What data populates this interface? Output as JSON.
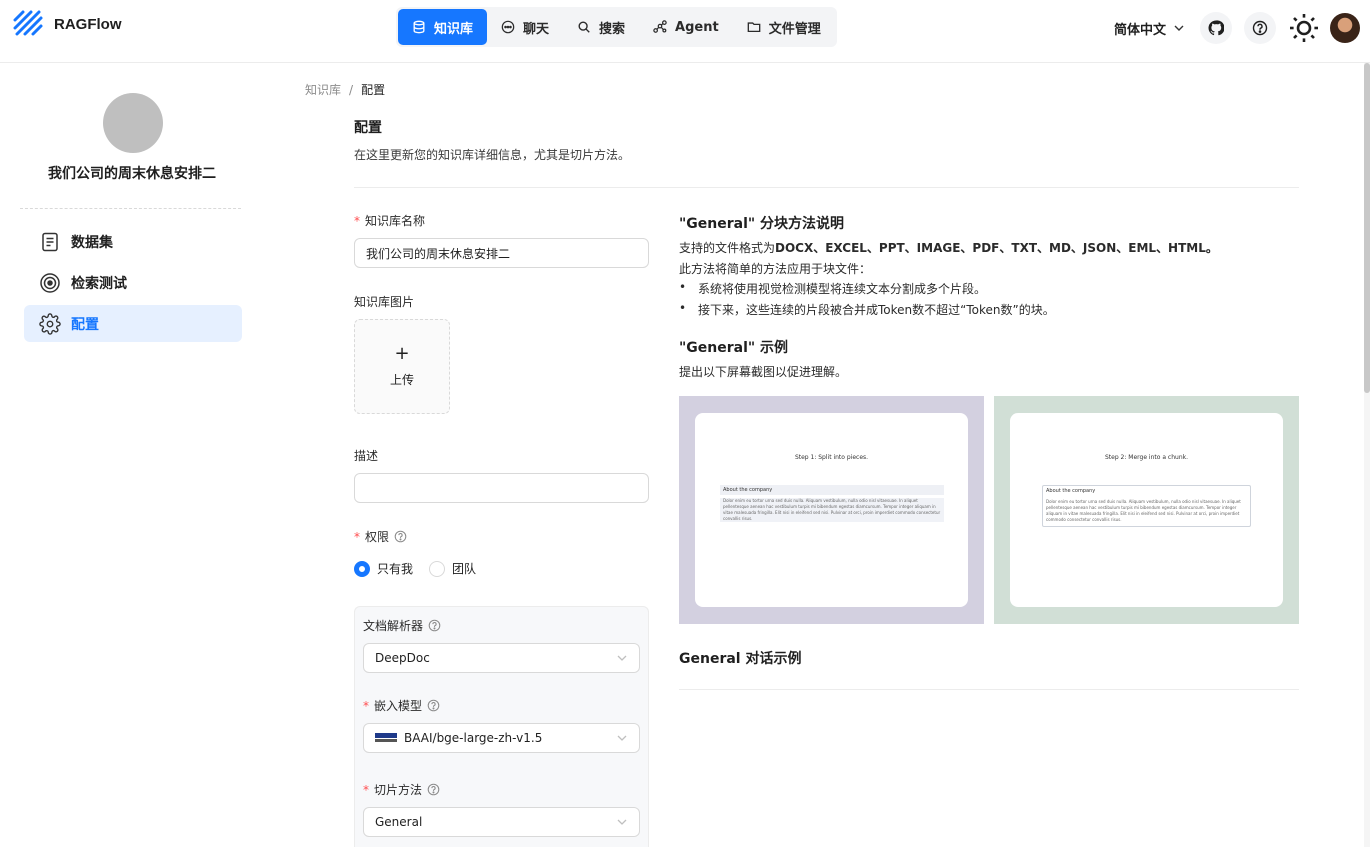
{
  "brand": {
    "name": "RAGFlow"
  },
  "nav": [
    {
      "label": "知识库",
      "icon": "database-icon",
      "active": true
    },
    {
      "label": "聊天",
      "icon": "chat-icon",
      "active": false
    },
    {
      "label": "搜索",
      "icon": "search-icon",
      "active": false
    },
    {
      "label": "Agent",
      "icon": "agent-icon",
      "active": false
    },
    {
      "label": "文件管理",
      "icon": "folder-icon",
      "active": false
    }
  ],
  "header": {
    "language": "简体中文"
  },
  "sidebar": {
    "kb_name": "我们公司的周末休息安排二",
    "items": [
      {
        "label": "数据集",
        "icon": "document-icon"
      },
      {
        "label": "检索测试",
        "icon": "target-icon"
      },
      {
        "label": "配置",
        "icon": "gear-icon",
        "active": true
      }
    ]
  },
  "breadcrumb": {
    "root": "知识库",
    "current": "配置"
  },
  "page": {
    "title": "配置",
    "description": "在这里更新您的知识库详细信息，尤其是切片方法。"
  },
  "form": {
    "name_label": "知识库名称",
    "name_value": "我们公司的周末休息安排二",
    "image_label": "知识库图片",
    "upload_label": "上传",
    "description_label": "描述",
    "description_value": "",
    "permission_label": "权限",
    "permission_options": [
      "只有我",
      "团队"
    ],
    "parser_label": "文档解析器",
    "parser_value": "DeepDoc",
    "embedding_label": "嵌入模型",
    "embedding_value": "BAAI/bge-large-zh-v1.5",
    "chunk_label": "切片方法",
    "chunk_value": "General"
  },
  "info": {
    "title": "\"General\" 分块方法说明",
    "formats_prefix": "支持的文件格式为",
    "formats": "DOCX、EXCEL、PPT、IMAGE、PDF、TXT、MD、JSON、EML、HTML。",
    "method_line": "此方法将简单的方法应用于块文件：",
    "bullets": [
      "系统将使用视觉检测模型将连续文本分割成多个片段。",
      "接下来，这些连续的片段被合并成Token数不超过“Token数”的块。"
    ],
    "example_title": "\"General\" 示例",
    "example_desc": "提出以下屏幕截图以促进理解。",
    "example_steps": [
      "Step 1: Split into pieces.",
      "Step 2: Merge into a chunk."
    ],
    "example_box_title": "About the company",
    "example_box_text": "Dolor enim eu tortor urna sed duis nulla. Aliquam vestibulum, nulla odio nisl vitaesuae. In aliquet pellentesque aenean hac vestibulum turpis mi bibendum egestas diamcursum. Tempor integer aliquam in vitae malesuada fringilla. Elit nisi in eleifend sed nisi. Pulvinar at orci, proin imperdiet commodo consectetur convallis risus.",
    "dialog_title": "General 对话示例"
  },
  "colors": {
    "primary": "#1677ff",
    "active_bg": "#e6f0ff",
    "required": "#ff4d4f"
  }
}
